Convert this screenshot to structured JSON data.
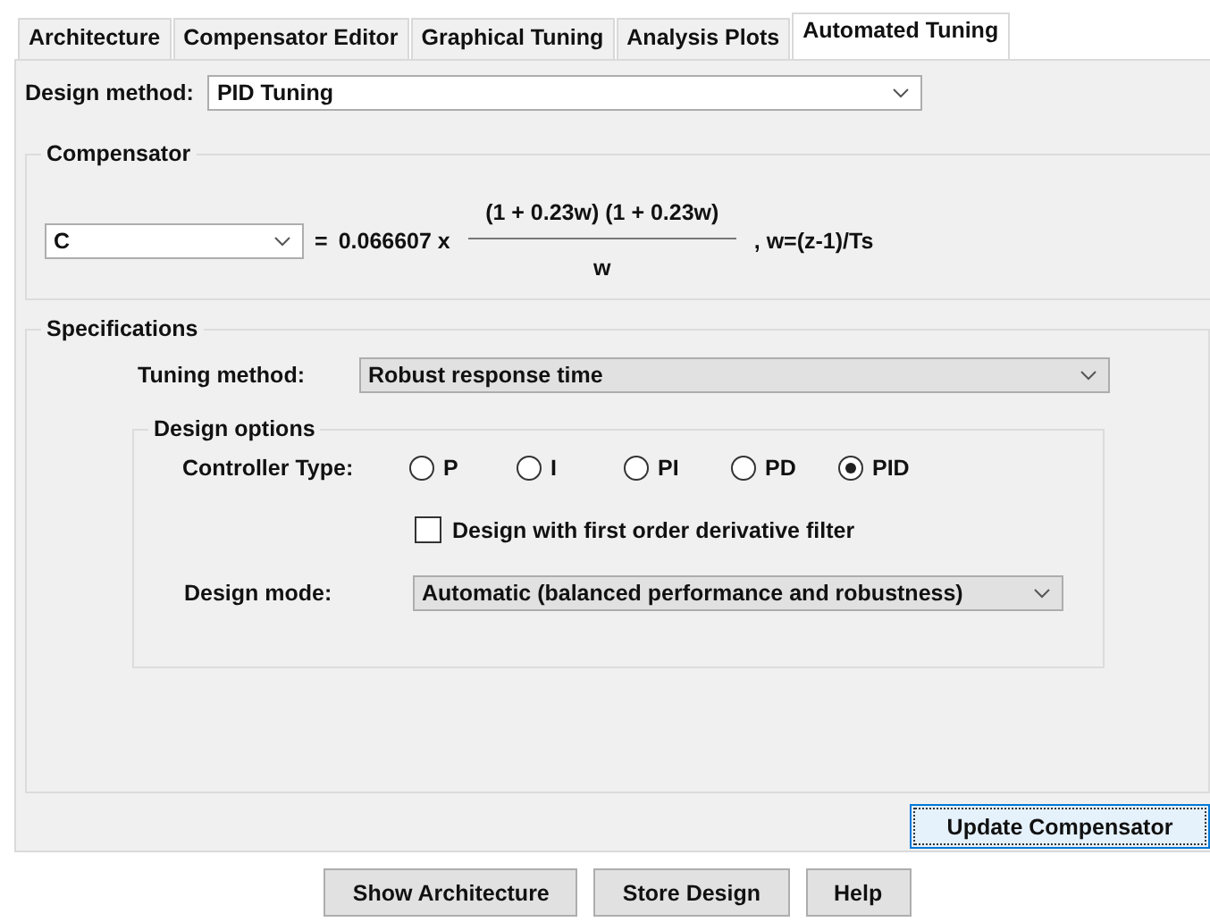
{
  "tabs": [
    {
      "label": "Architecture",
      "selected": false
    },
    {
      "label": "Compensator Editor",
      "selected": false
    },
    {
      "label": "Graphical Tuning",
      "selected": false
    },
    {
      "label": "Analysis Plots",
      "selected": false
    },
    {
      "label": "Automated Tuning",
      "selected": true
    }
  ],
  "design_method": {
    "label": "Design method:",
    "value": "PID Tuning"
  },
  "compensator": {
    "title": "Compensator",
    "name": "C",
    "equals": "=",
    "gain": "0.066607 x",
    "numerator": "(1 + 0.23w) (1 + 0.23w)",
    "denominator": "w",
    "suffix": ", w=(z-1)/Ts"
  },
  "specifications": {
    "title": "Specifications",
    "tuning_method": {
      "label": "Tuning method:",
      "value": "Robust response time"
    },
    "design_options": {
      "title": "Design options",
      "controller_type_label": "Controller Type:",
      "controller_types": [
        {
          "label": "P",
          "selected": false
        },
        {
          "label": "I",
          "selected": false
        },
        {
          "label": "PI",
          "selected": false
        },
        {
          "label": "PD",
          "selected": false
        },
        {
          "label": "PID",
          "selected": true
        }
      ],
      "derivative_filter": {
        "label": "Design with first order derivative filter",
        "checked": false
      },
      "design_mode": {
        "label": "Design mode:",
        "value": "Automatic (balanced performance and robustness)"
      }
    }
  },
  "update_button": "Update Compensator",
  "buttons": [
    "Show Architecture",
    "Store Design",
    "Help"
  ]
}
